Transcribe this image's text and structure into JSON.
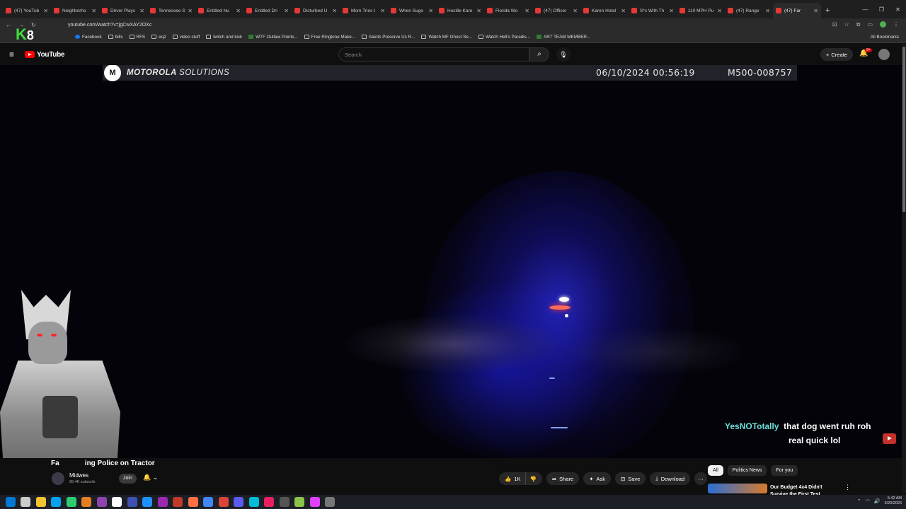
{
  "browser": {
    "tabs": [
      {
        "title": "(47) YouTub",
        "color": "#e53935"
      },
      {
        "title": "Neighborho",
        "color": "#e53935"
      },
      {
        "title": "Driver Plays",
        "color": "#e53935"
      },
      {
        "title": "Tennessee S",
        "color": "#e53935"
      },
      {
        "title": "Entitled Nu",
        "color": "#e53935"
      },
      {
        "title": "Entitled Dri",
        "color": "#e53935"
      },
      {
        "title": "Disturbed U",
        "color": "#e53935"
      },
      {
        "title": "Mom Tries t",
        "color": "#e53935"
      },
      {
        "title": "When Sugo",
        "color": "#e53935"
      },
      {
        "title": "Hostile Kare",
        "color": "#e53935"
      },
      {
        "title": "Florida Wo",
        "color": "#e53935"
      },
      {
        "title": "(47) Officer",
        "color": "#e53935"
      },
      {
        "title": "Karen Hotel",
        "color": "#e53935"
      },
      {
        "title": "S*x With Th",
        "color": "#e53935"
      },
      {
        "title": "110 MPH Pu",
        "color": "#e53935"
      },
      {
        "title": "(47) Range",
        "color": "#e53935"
      },
      {
        "title": "(47) Far",
        "color": "#e53935"
      }
    ],
    "url": "youtube.com/watch?v=jgCwXAY2OXc",
    "bookmarks": [
      {
        "label": "Facebook",
        "icon": "fb"
      },
      {
        "label": "bills",
        "icon": "folder"
      },
      {
        "label": "RFS",
        "icon": "folder"
      },
      {
        "label": "eq2",
        "icon": "folder"
      },
      {
        "label": "video stuff",
        "icon": "folder"
      },
      {
        "label": "twitch and kick",
        "icon": "folder"
      },
      {
        "label": "WTF Outlaw Points...",
        "icon": "g"
      },
      {
        "label": "Free Ringtone Make...",
        "icon": "folder"
      },
      {
        "label": "Saints Preserve Us R...",
        "icon": "folder"
      },
      {
        "label": "Watch MF Ghost Se...",
        "icon": "folder"
      },
      {
        "label": "Watch Hell's Paradis...",
        "icon": "folder"
      },
      {
        "label": "ART TEAM MEMBER...",
        "icon": "g"
      }
    ],
    "all_bookmarks": "All Bookmarks",
    "new_tab": "+",
    "win_controls": [
      "—",
      "❐",
      "✕"
    ],
    "nav_glyphs": [
      "←",
      "→",
      "↻"
    ]
  },
  "overlay_logo": {
    "k": "K",
    "n": "8"
  },
  "youtube": {
    "logo": "YouTube",
    "search_placeholder": "Search",
    "create_label": "Create",
    "notif_count": "9+",
    "menu_glyph": "≡",
    "search_glyph": "⌕",
    "mic_glyph": "🎙"
  },
  "video": {
    "brand_bold": "MOTOROLA",
    "brand_light": "SOLUTIONS",
    "brand_glyph": "M",
    "timestamp": "06/10/2024  00:56:19",
    "device_id": "M500-008757"
  },
  "chat": {
    "user": "YesNOTotally",
    "message_line1": "that dog went ruh roh",
    "message_line2": "real quick lol"
  },
  "below": {
    "title": "Fa             ing Police on Tractor",
    "channel": "Midwes",
    "subs": "95.4K subscrib",
    "join": "Join",
    "bell_glyph": "🔔",
    "actions": {
      "like": "1K",
      "share": "Share",
      "ask": "Ask",
      "save": "Save",
      "download": "Download"
    },
    "chips": [
      "All",
      "Politics News",
      "For you"
    ],
    "rec_title": "Our Budget 4x4 Didn't Survive the First Test"
  },
  "taskbar": {
    "time": "5:42 AM",
    "date": "3/20/2026",
    "icons": [
      "#0078d4",
      "#cccccc",
      "#f4c430",
      "#00a2ed",
      "#2ecc71",
      "#e67e22",
      "#8e44ad",
      "#ffffff",
      "#3f51b5",
      "#1e90ff",
      "#9c27b0",
      "#c0392b",
      "#ff7043",
      "#4285f4",
      "#db4437",
      "#5b5bf0",
      "#00bcd4",
      "#e91e63",
      "#555555",
      "#8bc34a",
      "#e040fb",
      "#777777"
    ]
  }
}
